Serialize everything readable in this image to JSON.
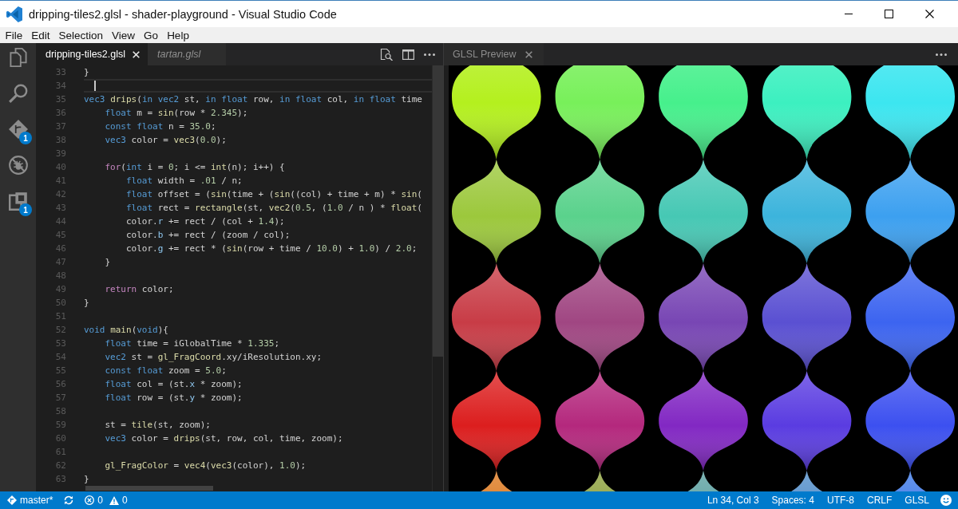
{
  "window": {
    "title": "dripping-tiles2.glsl - shader-playground - Visual Studio Code"
  },
  "menu": [
    "File",
    "Edit",
    "Selection",
    "View",
    "Go",
    "Help"
  ],
  "activity_bar": [
    {
      "kind": "files"
    },
    {
      "kind": "search"
    },
    {
      "kind": "git",
      "badge": "1"
    },
    {
      "kind": "debug"
    },
    {
      "kind": "extensions",
      "badge": "1"
    }
  ],
  "editor": {
    "tabs": [
      {
        "label": "dripping-tiles2.glsl",
        "selected": true,
        "preview": false
      },
      {
        "label": "tartan.glsl",
        "selected": false,
        "preview": true
      }
    ],
    "lines": [
      {
        "number": "33",
        "current": false,
        "tokens": [
          {
            "text": "}",
            "kind": "plain"
          }
        ]
      },
      {
        "number": "34",
        "current": true
      },
      {
        "number": "35",
        "current": false,
        "tokens": [
          {
            "text": "vec3 ",
            "kind": "keyword"
          },
          {
            "text": "drips",
            "kind": "function"
          },
          {
            "text": "(",
            "kind": "plain"
          },
          {
            "text": "in vec2",
            "kind": "keyword"
          },
          {
            "text": " st, ",
            "kind": "plain"
          },
          {
            "text": "in float",
            "kind": "keyword"
          },
          {
            "text": " row, ",
            "kind": "plain"
          },
          {
            "text": "in float",
            "kind": "keyword"
          },
          {
            "text": " col, ",
            "kind": "plain"
          },
          {
            "text": "in float",
            "kind": "keyword"
          },
          {
            "text": " time",
            "kind": "plain"
          }
        ]
      },
      {
        "number": "36",
        "current": false,
        "tokens": [
          {
            "text": "    float",
            "kind": "keyword"
          },
          {
            "text": " m = ",
            "kind": "plain"
          },
          {
            "text": "sin",
            "kind": "function"
          },
          {
            "text": "(row * ",
            "kind": "plain"
          },
          {
            "text": "2.345",
            "kind": "number"
          },
          {
            "text": ");",
            "kind": "plain"
          }
        ]
      },
      {
        "number": "37",
        "current": false,
        "tokens": [
          {
            "text": "    const float",
            "kind": "keyword"
          },
          {
            "text": " n = ",
            "kind": "plain"
          },
          {
            "text": "35.0",
            "kind": "number"
          },
          {
            "text": ";",
            "kind": "plain"
          }
        ]
      },
      {
        "number": "38",
        "current": false,
        "tokens": [
          {
            "text": "    vec3",
            "kind": "keyword"
          },
          {
            "text": " color = ",
            "kind": "plain"
          },
          {
            "text": "vec3",
            "kind": "function"
          },
          {
            "text": "(",
            "kind": "plain"
          },
          {
            "text": "0.0",
            "kind": "number"
          },
          {
            "text": ");",
            "kind": "plain"
          }
        ]
      },
      {
        "number": "39",
        "current": false
      },
      {
        "number": "40",
        "current": false,
        "tokens": [
          {
            "text": "    for",
            "kind": "control"
          },
          {
            "text": "(",
            "kind": "plain"
          },
          {
            "text": "int",
            "kind": "keyword"
          },
          {
            "text": " i = ",
            "kind": "plain"
          },
          {
            "text": "0",
            "kind": "number"
          },
          {
            "text": "; i <= ",
            "kind": "plain"
          },
          {
            "text": "int",
            "kind": "function"
          },
          {
            "text": "(n); i++) {",
            "kind": "plain"
          }
        ]
      },
      {
        "number": "41",
        "current": false,
        "tokens": [
          {
            "text": "        float",
            "kind": "keyword"
          },
          {
            "text": " width = ",
            "kind": "plain"
          },
          {
            "text": ".01",
            "kind": "number"
          },
          {
            "text": " / n;",
            "kind": "plain"
          }
        ]
      },
      {
        "number": "42",
        "current": false,
        "tokens": [
          {
            "text": "        float",
            "kind": "keyword"
          },
          {
            "text": " offset = (",
            "kind": "plain"
          },
          {
            "text": "sin",
            "kind": "function"
          },
          {
            "text": "(time + (",
            "kind": "plain"
          },
          {
            "text": "sin",
            "kind": "function"
          },
          {
            "text": "((col) + time + m) * ",
            "kind": "plain"
          },
          {
            "text": "sin",
            "kind": "function"
          },
          {
            "text": "(",
            "kind": "plain"
          }
        ]
      },
      {
        "number": "43",
        "current": false,
        "tokens": [
          {
            "text": "        float",
            "kind": "keyword"
          },
          {
            "text": " rect = ",
            "kind": "plain"
          },
          {
            "text": "rectangle",
            "kind": "function"
          },
          {
            "text": "(st, ",
            "kind": "plain"
          },
          {
            "text": "vec2",
            "kind": "function"
          },
          {
            "text": "(",
            "kind": "plain"
          },
          {
            "text": "0.5",
            "kind": "number"
          },
          {
            "text": ", (",
            "kind": "plain"
          },
          {
            "text": "1.0",
            "kind": "number"
          },
          {
            "text": " / n ) * ",
            "kind": "plain"
          },
          {
            "text": "float",
            "kind": "function"
          },
          {
            "text": "(",
            "kind": "plain"
          }
        ]
      },
      {
        "number": "44",
        "current": false,
        "tokens": [
          {
            "text": "        color.",
            "kind": "plain"
          },
          {
            "text": "r",
            "kind": "member"
          },
          {
            "text": " += rect / (col + ",
            "kind": "plain"
          },
          {
            "text": "1.4",
            "kind": "number"
          },
          {
            "text": ");",
            "kind": "plain"
          }
        ]
      },
      {
        "number": "45",
        "current": false,
        "tokens": [
          {
            "text": "        color.",
            "kind": "plain"
          },
          {
            "text": "b",
            "kind": "member"
          },
          {
            "text": " += rect / (zoom / col);",
            "kind": "plain"
          }
        ]
      },
      {
        "number": "46",
        "current": false,
        "tokens": [
          {
            "text": "        color.",
            "kind": "plain"
          },
          {
            "text": "g",
            "kind": "member"
          },
          {
            "text": " += rect * (",
            "kind": "plain"
          },
          {
            "text": "sin",
            "kind": "function"
          },
          {
            "text": "(row + time / ",
            "kind": "plain"
          },
          {
            "text": "10.0",
            "kind": "number"
          },
          {
            "text": ") + ",
            "kind": "plain"
          },
          {
            "text": "1.0",
            "kind": "number"
          },
          {
            "text": ") / ",
            "kind": "plain"
          },
          {
            "text": "2.0",
            "kind": "number"
          },
          {
            "text": ";",
            "kind": "plain"
          }
        ]
      },
      {
        "number": "47",
        "current": false,
        "tokens": [
          {
            "text": "    }",
            "kind": "plain"
          }
        ]
      },
      {
        "number": "48",
        "current": false
      },
      {
        "number": "49",
        "current": false,
        "tokens": [
          {
            "text": "    return",
            "kind": "control"
          },
          {
            "text": " color;",
            "kind": "plain"
          }
        ]
      },
      {
        "number": "50",
        "current": false,
        "tokens": [
          {
            "text": "}",
            "kind": "plain"
          }
        ]
      },
      {
        "number": "51",
        "current": false
      },
      {
        "number": "52",
        "current": false,
        "tokens": [
          {
            "text": "void ",
            "kind": "keyword"
          },
          {
            "text": "main",
            "kind": "function"
          },
          {
            "text": "(",
            "kind": "plain"
          },
          {
            "text": "void",
            "kind": "keyword"
          },
          {
            "text": "){",
            "kind": "plain"
          }
        ]
      },
      {
        "number": "53",
        "current": false,
        "tokens": [
          {
            "text": "    float",
            "kind": "keyword"
          },
          {
            "text": " time = iGlobalTime * ",
            "kind": "plain"
          },
          {
            "text": "1.335",
            "kind": "number"
          },
          {
            "text": ";",
            "kind": "plain"
          }
        ]
      },
      {
        "number": "54",
        "current": false,
        "tokens": [
          {
            "text": "    vec2",
            "kind": "keyword"
          },
          {
            "text": " st = ",
            "kind": "plain"
          },
          {
            "text": "gl_FragCoord",
            "kind": "function"
          },
          {
            "text": ".xy/iResolution.xy;",
            "kind": "plain"
          }
        ]
      },
      {
        "number": "55",
        "current": false,
        "tokens": [
          {
            "text": "    const float",
            "kind": "keyword"
          },
          {
            "text": " zoom = ",
            "kind": "plain"
          },
          {
            "text": "5.0",
            "kind": "number"
          },
          {
            "text": ";",
            "kind": "plain"
          }
        ]
      },
      {
        "number": "56",
        "current": false,
        "tokens": [
          {
            "text": "    float",
            "kind": "keyword"
          },
          {
            "text": " col = (st.",
            "kind": "plain"
          },
          {
            "text": "x",
            "kind": "member"
          },
          {
            "text": " * zoom);",
            "kind": "plain"
          }
        ]
      },
      {
        "number": "57",
        "current": false,
        "tokens": [
          {
            "text": "    float",
            "kind": "keyword"
          },
          {
            "text": " row = (st.",
            "kind": "plain"
          },
          {
            "text": "y",
            "kind": "member"
          },
          {
            "text": " * zoom);",
            "kind": "plain"
          }
        ]
      },
      {
        "number": "58",
        "current": false
      },
      {
        "number": "59",
        "current": false,
        "tokens": [
          {
            "text": "    st = ",
            "kind": "plain"
          },
          {
            "text": "tile",
            "kind": "function"
          },
          {
            "text": "(st, zoom);",
            "kind": "plain"
          }
        ]
      },
      {
        "number": "60",
        "current": false,
        "tokens": [
          {
            "text": "    vec3",
            "kind": "keyword"
          },
          {
            "text": " color = ",
            "kind": "plain"
          },
          {
            "text": "drips",
            "kind": "function"
          },
          {
            "text": "(st, row, col, time, zoom);",
            "kind": "plain"
          }
        ]
      },
      {
        "number": "61",
        "current": false
      },
      {
        "number": "62",
        "current": false,
        "tokens": [
          {
            "text": "    gl_FragColor",
            "kind": "function"
          },
          {
            "text": " = ",
            "kind": "plain"
          },
          {
            "text": "vec4",
            "kind": "function"
          },
          {
            "text": "(",
            "kind": "plain"
          },
          {
            "text": "vec3",
            "kind": "function"
          },
          {
            "text": "(color), ",
            "kind": "plain"
          },
          {
            "text": "1.0",
            "kind": "number"
          },
          {
            "text": ");",
            "kind": "plain"
          }
        ]
      },
      {
        "number": "63",
        "current": false,
        "tokens": [
          {
            "text": "}",
            "kind": "plain"
          }
        ]
      }
    ]
  },
  "preview_pane": {
    "tab": {
      "label": "GLSL Preview"
    }
  },
  "status_bar": {
    "branch": "master*",
    "errors": "0",
    "warnings": "0",
    "items": [
      "Ln 34, Col 3",
      "Spaces: 4",
      "UTF-8",
      "CRLF",
      "GLSL"
    ]
  }
}
